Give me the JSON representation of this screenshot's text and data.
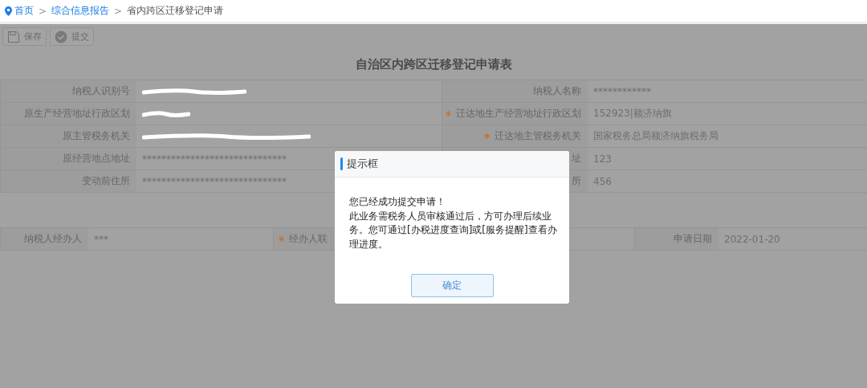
{
  "breadcrumb": [
    {
      "label": "首页",
      "link": true
    },
    {
      "label": "综合信息报告",
      "link": true
    },
    {
      "label": "省内跨区迁移登记申请",
      "link": false
    }
  ],
  "separator": ">",
  "toolbar": [
    {
      "label": "保存"
    },
    {
      "label": "提交"
    }
  ],
  "form_title": "自治区内跨区迁移登记申请表",
  "rows": [
    {
      "left": {
        "label": "纳税人识别号",
        "redacted": true
      },
      "right": {
        "label": "纳税人名称",
        "value": "************"
      }
    },
    {
      "left": {
        "label": "原生产经营地址行政区划",
        "redacted": true
      },
      "right": {
        "label": "迁达地生产经营地址行政区划",
        "required": true,
        "value": "152923|额济纳旗"
      }
    },
    {
      "left": {
        "label": "原主管税务机关",
        "redacted": true
      },
      "right": {
        "label": "迁达地主管税务机关",
        "required": true,
        "value": "国家税务总局额济纳旗税务局"
      }
    },
    {
      "left": {
        "label": "原经营地点地址",
        "value": "******************************"
      },
      "right": {
        "label": "址",
        "value": "123"
      }
    },
    {
      "left": {
        "label": "变动前住所",
        "value": "******************************"
      },
      "right": {
        "label": "所",
        "value": "456"
      }
    }
  ],
  "applicant_row": [
    {
      "label": "纳税人经办人",
      "value": "***"
    },
    {
      "label": "经办人联",
      "required": true
    },
    {
      "label": "申请日期",
      "value": "2022-01-20"
    }
  ],
  "dialog": {
    "title": "提示框",
    "lines": [
      "您已经成功提交申请！",
      "此业务需税务人员审核通过后，方可办理后续业务。您可通过[办税进度查询]或[服务提醒]查看办理进度。"
    ],
    "button": "确定"
  }
}
